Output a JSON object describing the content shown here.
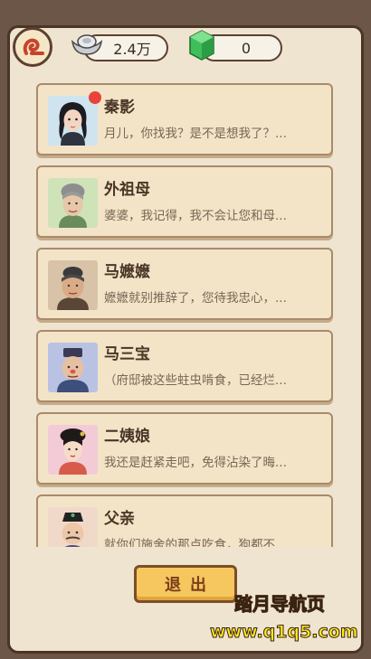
{
  "header": {
    "back_icon": "scroll-swirl-icon",
    "silver": {
      "icon": "silver-ingot-icon",
      "value": "2.4万"
    },
    "jade": {
      "icon": "jade-gem-icon",
      "value": "0"
    }
  },
  "contacts": [
    {
      "name": "秦影",
      "message": "月儿，你找我？是不是想我了？...",
      "unread": true,
      "avatar": "young-man-portrait"
    },
    {
      "name": "外祖母",
      "message": "婆婆，我记得，我不会让您和母...",
      "unread": false,
      "avatar": "grandmother-portrait"
    },
    {
      "name": "马嬷嬷",
      "message": "嬷嬷就别推辞了，您待我忠心，...",
      "unread": false,
      "avatar": "old-nanny-portrait"
    },
    {
      "name": "马三宝",
      "message": "（府邸被这些蛀虫啃食，已经烂...",
      "unread": false,
      "avatar": "old-man-portrait"
    },
    {
      "name": "二姨娘",
      "message": "我还是赶紧走吧，免得沾染了晦...",
      "unread": false,
      "avatar": "concubine-portrait"
    },
    {
      "name": "父亲",
      "message": "就你们施舍的那点吃食，狗都不...",
      "unread": false,
      "avatar": "father-portrait"
    }
  ],
  "exit_label": "退出",
  "watermark": {
    "title": "踏月导航页",
    "url": "www.q1q5.com"
  },
  "colors": {
    "badge": "#e8433b",
    "card_bg": "#f3e4c8",
    "button": "#f6c75f"
  }
}
